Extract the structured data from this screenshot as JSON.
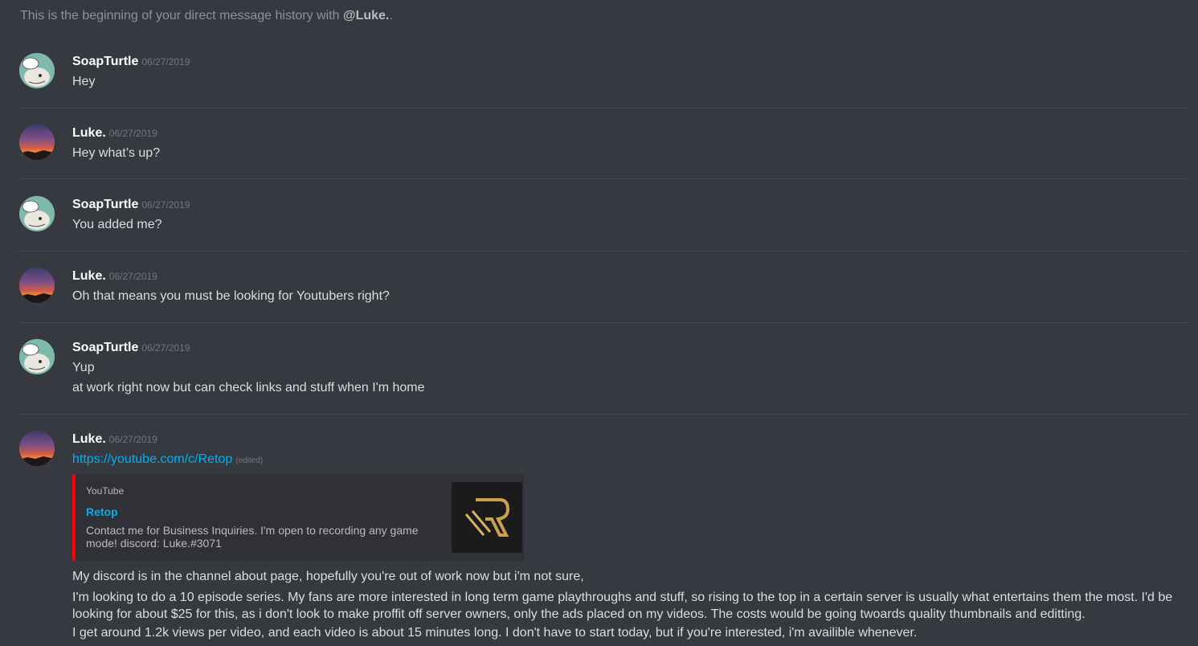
{
  "intro": {
    "prefix": "This is the beginning of your direct message history with ",
    "mention": "@Luke.",
    "suffix": "."
  },
  "messages": [
    {
      "author": "SoapTurtle",
      "timestamp": "06/27/2019",
      "lines": [
        "Hey"
      ]
    },
    {
      "author": "Luke.",
      "timestamp": "06/27/2019",
      "lines": [
        "Hey what’s up?"
      ]
    },
    {
      "author": "SoapTurtle",
      "timestamp": "06/27/2019",
      "lines": [
        "You added me?"
      ]
    },
    {
      "author": "Luke.",
      "timestamp": "06/27/2019",
      "lines": [
        "Oh that means you must be looking for Youtubers right?"
      ]
    },
    {
      "author": "SoapTurtle",
      "timestamp": "06/27/2019",
      "lines": [
        "Yup",
        "at work right now but can check links and stuff when I'm home"
      ]
    },
    {
      "author": "Luke.",
      "timestamp": "06/27/2019",
      "link": "https://youtube.com/c/Retop",
      "edited": "(edited)",
      "embed": {
        "provider": "YouTube",
        "title": "Retop",
        "description": "Contact me for Business Inquiries. I'm open to recording any game mode! discord: Luke.#3071"
      },
      "lines": [
        "My discord is in the channel about page, hopefully you're out of work now but i'm not sure,",
        "I'm looking to do a 10 episode series. My fans are more interested in long term game playthroughs and stuff, so rising to the top in a certain server is usually what entertains them the most. I'd be looking for about $25 for this, as i don't look to make proffit off server owners, only the ads placed on my videos. The costs would be going twoards quality thumbnails and editting.",
        "I get around 1.2k views per video, and each video is about 15 minutes long. I don't have to start today, but if you're interested, i'm availible whenever."
      ]
    }
  ],
  "colors": {
    "background": "#36393f",
    "link": "#00b0f4",
    "embed_border": "#ff0000"
  },
  "icons": {
    "soapturtle_avatar": "turtle-avatar-icon",
    "luke_avatar": "sunset-avatar-icon",
    "embed_thumbnail": "retop-logo-icon"
  }
}
